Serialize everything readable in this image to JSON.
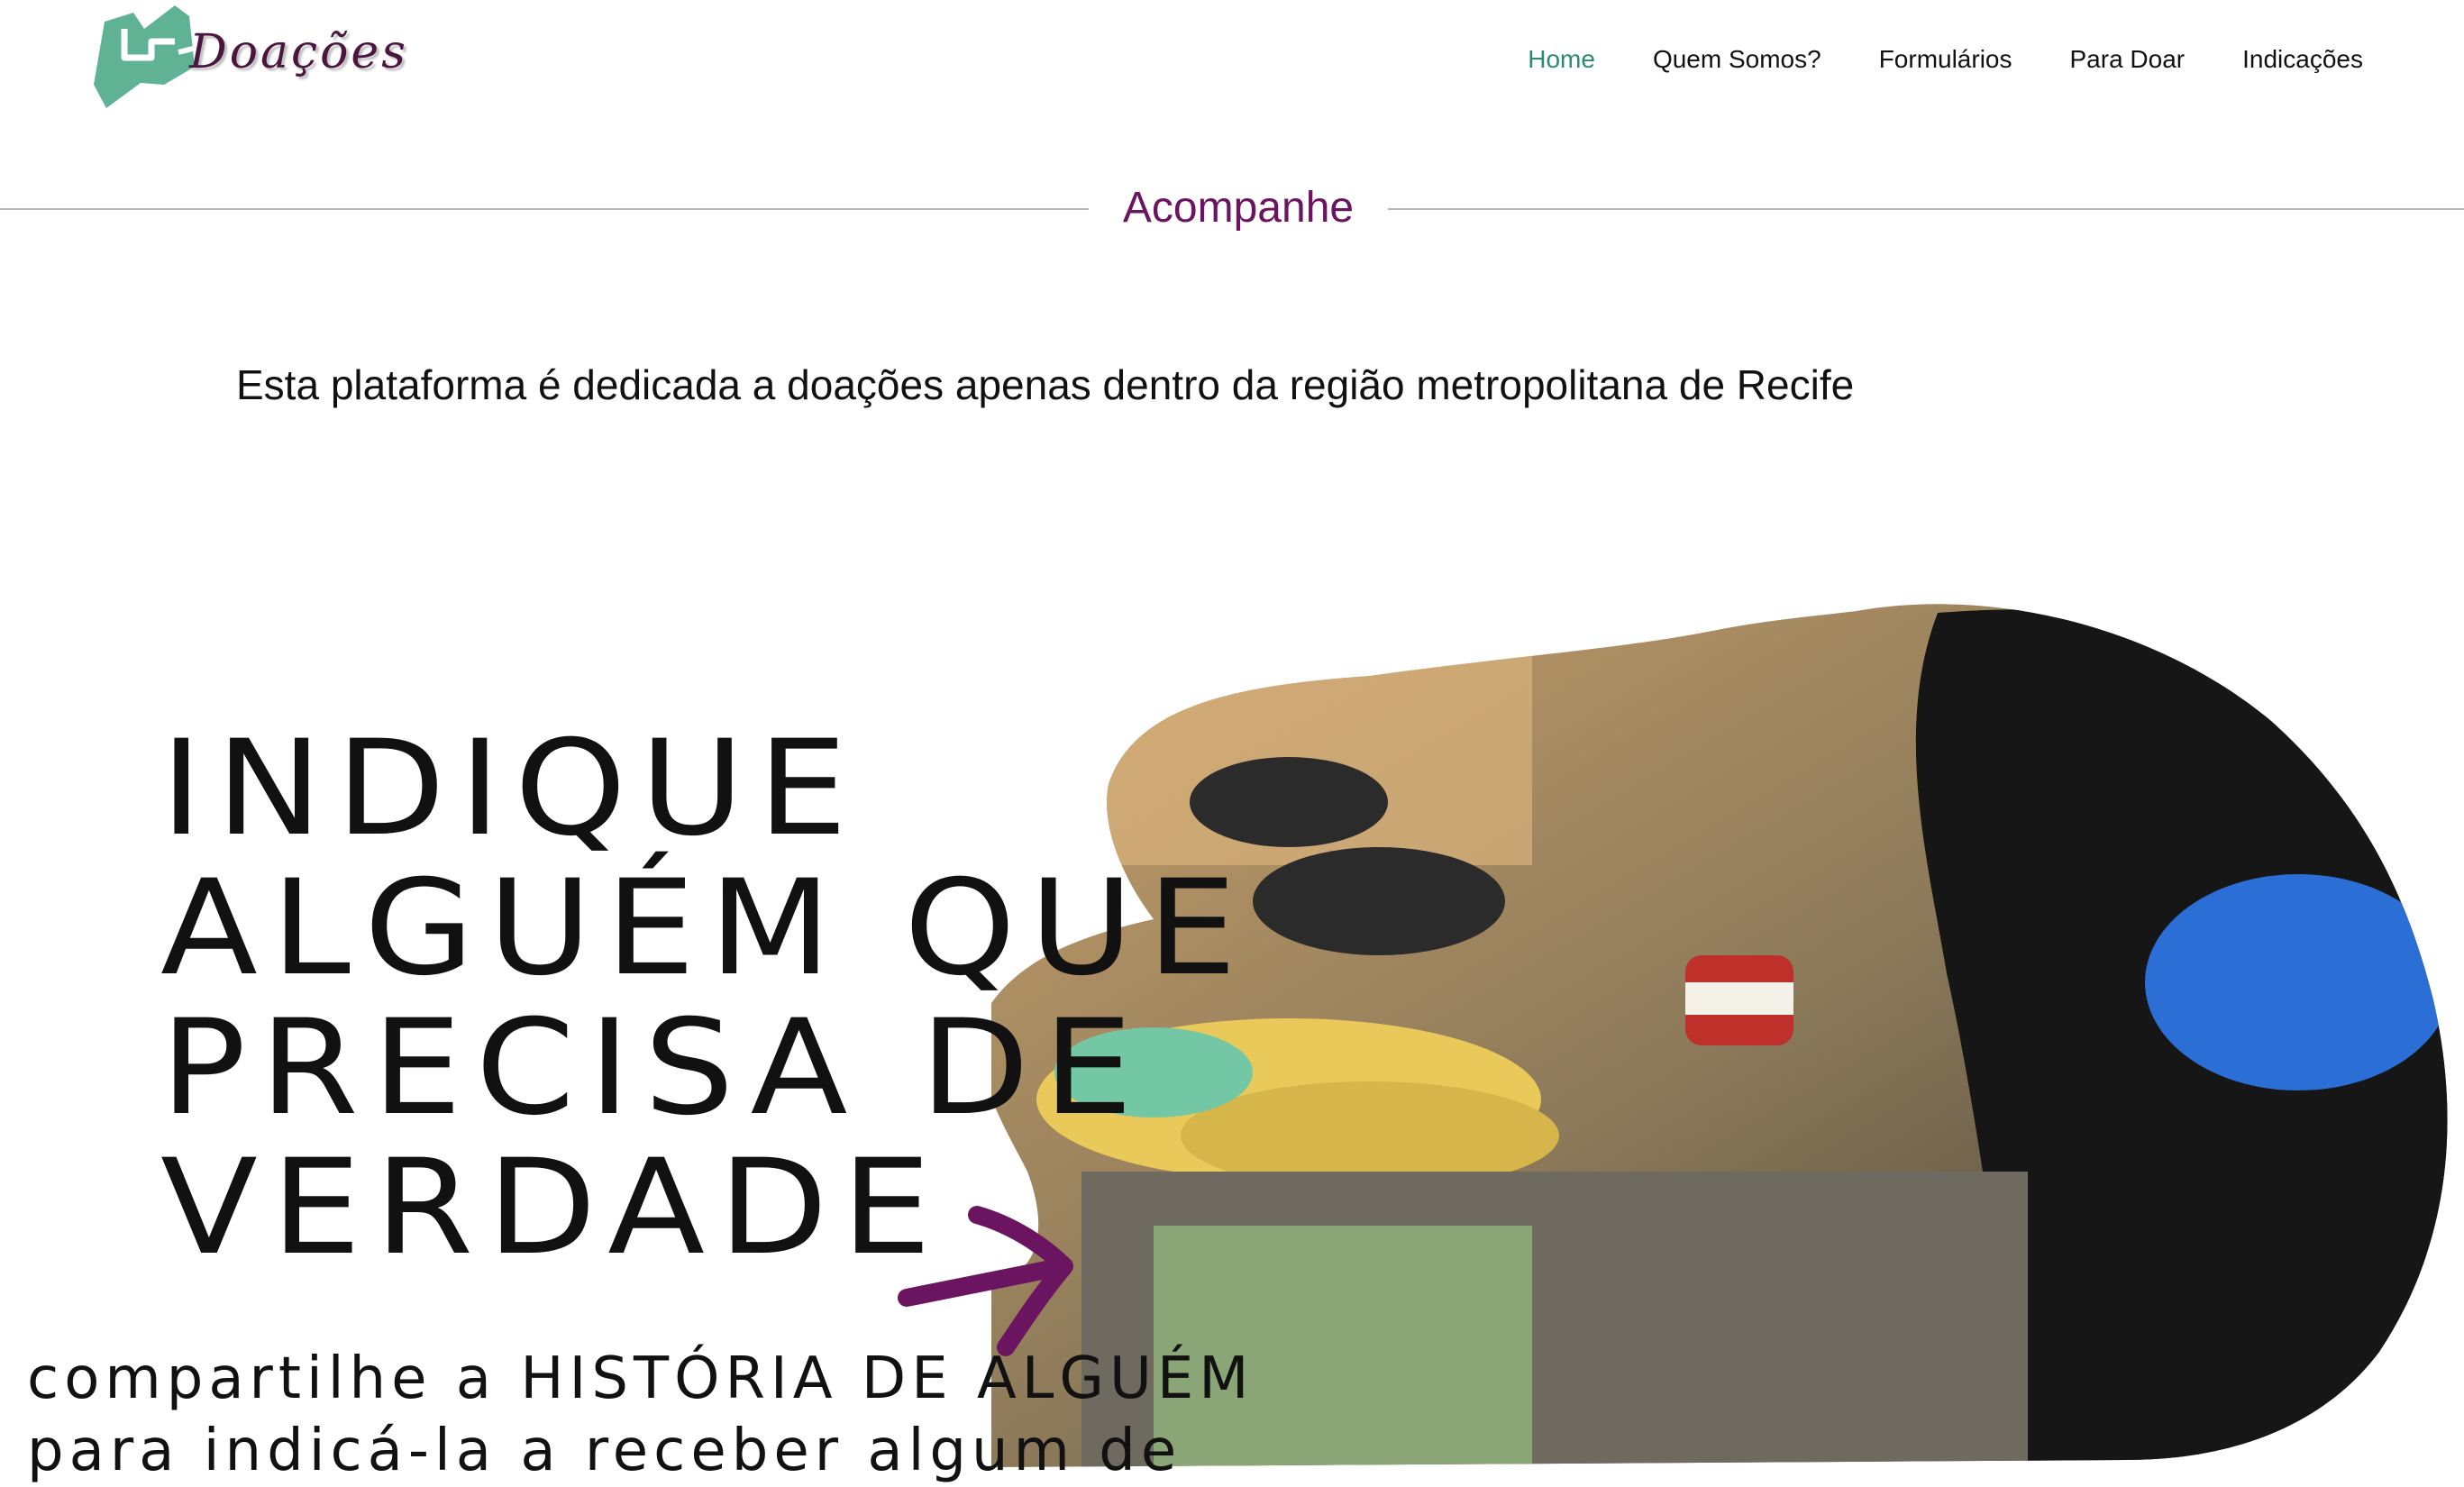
{
  "brand": {
    "logo_text": "Doações"
  },
  "nav": {
    "items": [
      {
        "label": "Home",
        "active": true
      },
      {
        "label": "Quem Somos?"
      },
      {
        "label": "Formulários"
      },
      {
        "label": "Para Doar"
      },
      {
        "label": "Indicações"
      }
    ]
  },
  "section": {
    "title": "Acompanhe"
  },
  "notice": "Esta plataforma é dedicada a doações apenas dentro da região metropolitana de Recife",
  "hero": {
    "headline_lines": [
      "INDIQUE",
      "ALGUÉM QUE",
      "PRECISA DE",
      "VERDADE"
    ],
    "subtext_lines": [
      "compartilhe a HISTÓRIA DE ALGUÉM",
      "para indicá-la a receber algum de"
    ],
    "image_alt": "food-donation-volunteers-photo"
  },
  "colors": {
    "accent": "#6b1560",
    "brand_green": "#5fb394",
    "nav_active": "#2e8a6e"
  }
}
